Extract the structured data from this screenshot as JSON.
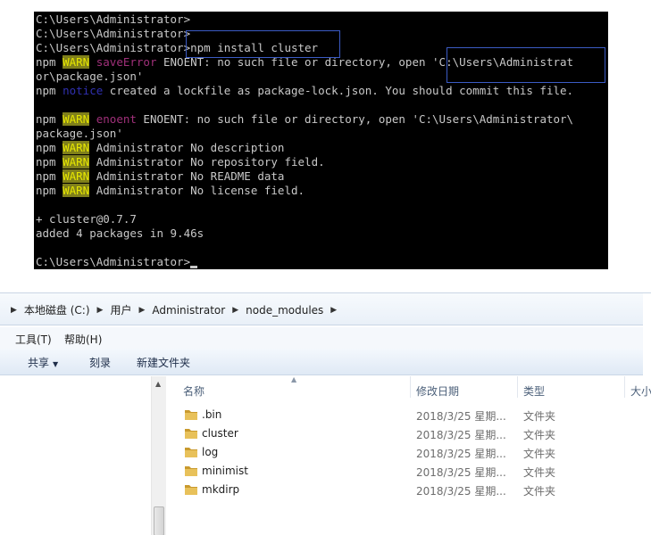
{
  "terminal": {
    "lines": [
      {
        "segments": [
          {
            "text": "C:\\Users\\Administrator>"
          }
        ]
      },
      {
        "segments": [
          {
            "text": "C:\\Users\\Administrator>"
          }
        ]
      },
      {
        "segments": [
          {
            "text": "C:\\Users\\Administrator>npm install cluster"
          }
        ]
      },
      {
        "segments": [
          {
            "text": "npm "
          },
          {
            "text": "WARN",
            "style": "warn"
          },
          {
            "text": " "
          },
          {
            "text": "saveError",
            "style": "saveerr"
          },
          {
            "text": " ENOENT: no such file or directory, open 'C:\\Users\\Administrat"
          }
        ]
      },
      {
        "segments": [
          {
            "text": "or\\package.json'"
          }
        ]
      },
      {
        "segments": [
          {
            "text": "npm "
          },
          {
            "text": "notice",
            "style": "notice"
          },
          {
            "text": " created a lockfile as package-lock.json. You should commit this file."
          }
        ]
      },
      {
        "segments": [
          {
            "text": ""
          }
        ]
      },
      {
        "segments": [
          {
            "text": "npm "
          },
          {
            "text": "WARN",
            "style": "warn"
          },
          {
            "text": " "
          },
          {
            "text": "enoent",
            "style": "enoent-code"
          },
          {
            "text": " ENOENT: no such file or directory, open 'C:\\Users\\Administrator\\"
          }
        ]
      },
      {
        "segments": [
          {
            "text": "package.json'"
          }
        ]
      },
      {
        "segments": [
          {
            "text": "npm "
          },
          {
            "text": "WARN",
            "style": "warn"
          },
          {
            "text": " Administrator No description"
          }
        ]
      },
      {
        "segments": [
          {
            "text": "npm "
          },
          {
            "text": "WARN",
            "style": "warn"
          },
          {
            "text": " Administrator No repository field."
          }
        ]
      },
      {
        "segments": [
          {
            "text": "npm "
          },
          {
            "text": "WARN",
            "style": "warn"
          },
          {
            "text": " Administrator No README data"
          }
        ]
      },
      {
        "segments": [
          {
            "text": "npm "
          },
          {
            "text": "WARN",
            "style": "warn"
          },
          {
            "text": " Administrator No license field."
          }
        ]
      },
      {
        "segments": [
          {
            "text": ""
          }
        ]
      },
      {
        "segments": [
          {
            "text": "+ cluster@0.7.7"
          }
        ]
      },
      {
        "segments": [
          {
            "text": "added 4 packages in 9.46s"
          }
        ]
      },
      {
        "segments": [
          {
            "text": ""
          }
        ]
      },
      {
        "segments": [
          {
            "text": "C:\\Users\\Administrator>"
          },
          {
            "text": "",
            "style": "cursor"
          }
        ]
      }
    ]
  },
  "explorer": {
    "breadcrumb": [
      "本地磁盘 (C:)",
      "用户",
      "Administrator",
      "node_modules"
    ],
    "menu": [
      "工具(T)",
      "帮助(H)"
    ],
    "toolbar": {
      "share": "共享",
      "burn": "刻录",
      "new_folder": "新建文件夹"
    },
    "columns": {
      "name": "名称",
      "modified": "修改日期",
      "type": "类型",
      "size": "大小"
    },
    "files": [
      {
        "name": ".bin",
        "modified": "2018/3/25 星期...",
        "type": "文件夹"
      },
      {
        "name": "cluster",
        "modified": "2018/3/25 星期...",
        "type": "文件夹"
      },
      {
        "name": "log",
        "modified": "2018/3/25 星期...",
        "type": "文件夹"
      },
      {
        "name": "minimist",
        "modified": "2018/3/25 星期...",
        "type": "文件夹"
      },
      {
        "name": "mkdirp",
        "modified": "2018/3/25 星期...",
        "type": "文件夹"
      }
    ],
    "colors": {
      "folder": "#e8c15a",
      "folder_dark": "#c99a2e",
      "highlight_box": "#3b5bc4"
    }
  }
}
